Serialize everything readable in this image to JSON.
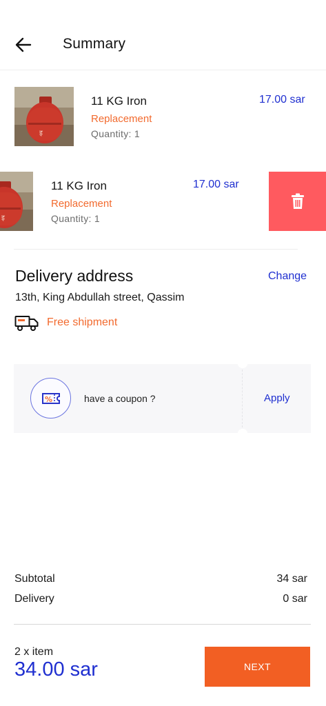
{
  "header": {
    "title": "Summary"
  },
  "items": [
    {
      "name": "11 KG Iron",
      "type": "Replacement",
      "quantity": "Quantity: 1",
      "price": "17.00 sar"
    },
    {
      "name": "11 KG Iron",
      "type": "Replacement",
      "quantity": "Quantity: 1",
      "price": "17.00 sar"
    }
  ],
  "delivery": {
    "title": "Delivery address",
    "change_label": "Change",
    "address": "13th, King Abdullah street, Qassim",
    "shipment": "Free shipment"
  },
  "coupon": {
    "text": "have a coupon ?",
    "apply_label": "Apply",
    "icon_glyph": "%"
  },
  "summary": {
    "subtotal_label": "Subtotal",
    "subtotal_value": "34 sar",
    "delivery_label": "Delivery",
    "delivery_value": "0 sar"
  },
  "footer": {
    "item_count": "2 x item",
    "total": "34.00 sar",
    "next_label": "NEXT"
  },
  "colors": {
    "accent": "#1f2fd0",
    "orange": "#f26a2e",
    "delete": "#ff5a5f",
    "button": "#f25f23"
  },
  "icons": {
    "back": "arrow-left-icon",
    "delete": "trash-icon",
    "truck": "truck-icon",
    "coupon": "coupon-icon"
  }
}
